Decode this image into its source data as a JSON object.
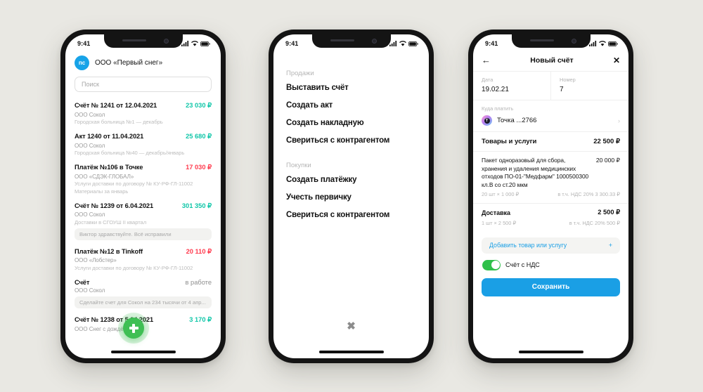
{
  "statusbar": {
    "time": "9:41",
    "signal_icon": "cellular-bars-icon",
    "wifi_icon": "wifi-icon",
    "battery_icon": "battery-icon"
  },
  "phone1": {
    "avatar_initials": "пс",
    "company": "ООО «Первый снег»",
    "search_placeholder": "Поиск",
    "fab_icon": "plus-icon",
    "items": [
      {
        "title": "Счёт № 1241 от 12.04.2021",
        "amount": "23 030 ₽",
        "amount_kind": "in",
        "sub": "ООО Сокол",
        "sub2": "Городская больница №1 — декабрь",
        "bubble": ""
      },
      {
        "title": "Акт 1240 от 11.04.2021",
        "amount": "25 680 ₽",
        "amount_kind": "in",
        "sub": "ООО Сокол",
        "sub2": "Городская больница №40 — декабрь/январь",
        "bubble": ""
      },
      {
        "title": "Платёж №106 в Точке",
        "amount": "17 030 ₽",
        "amount_kind": "out",
        "sub": "ООО «СДЭК-ГЛОБАЛ»",
        "sub2": "Услуги доставки по договору № КУ-РФ-ГЛ-11002",
        "sub3": "Материалы за январь",
        "bubble": ""
      },
      {
        "title": "Счёт № 1239 от 6.04.2021",
        "amount": "301 350 ₽",
        "amount_kind": "in",
        "sub": "ООО Сокол",
        "sub2": "Доставки в СГОУШ II квартал",
        "bubble": "Виктор здравствуйте. Всё исправили"
      },
      {
        "title": "Платёж №12 в Tinkoff",
        "amount": "20 110 ₽",
        "amount_kind": "out",
        "sub": "ООО «Лобстер»",
        "sub2": "Услуги доставки по договору № КУ-РФ-ГЛ-11002",
        "bubble": ""
      },
      {
        "title": "Счёт",
        "amount": "в работе",
        "amount_kind": "note",
        "sub": "ООО Сокол",
        "sub2": "",
        "bubble": "Сделайте счет для Сокол на 234 тысячи от 4 апр..."
      },
      {
        "title": "Счёт № 1238 от 5.04.2021",
        "amount": "3 170 ₽",
        "amount_kind": "in",
        "sub": "ООО Снег с дождём",
        "sub2": "",
        "bubble": ""
      }
    ]
  },
  "phone2": {
    "close_icon": "close-x-icon",
    "groups": [
      {
        "label": "Продажи",
        "items": [
          "Выставить счёт",
          "Создать акт",
          "Создать накладную",
          "Свериться с контрагентом"
        ]
      },
      {
        "label": "Покупки",
        "items": [
          "Создать платёжку",
          "Учесть первичку",
          "Свериться с контрагентом"
        ]
      }
    ]
  },
  "phone3": {
    "back_icon": "arrow-left-icon",
    "title": "Новый счёт",
    "close_icon": "close-x-icon",
    "date_label": "Дата",
    "date_value": "19.02.21",
    "number_label": "Номер",
    "number_value": "7",
    "pay_label": "Куда платить",
    "pay_account": "Точка ...2766",
    "pay_avatar_letter": "Т",
    "chevron_icon": "chevron-right-icon",
    "goods_label": "Товары и услуги",
    "goods_total": "22 500 ₽",
    "items": [
      {
        "name": "Пакет одноразовый для сбора, хранения и удаления медицинских отходов ПО-01-\"Медфарм\" 1000500300 кл.В со ст.20 мкм",
        "price": "20 000 ₽",
        "qty": "20 шт × 1 000 ₽",
        "vat": "в т.ч. НДС 20% 3 300.33 ₽",
        "bold": false
      },
      {
        "name": "Доставка",
        "price": "2 500 ₽",
        "qty": "1 шт × 2 500 ₽",
        "vat": "в т.ч. НДС 20% 500 ₽",
        "bold": true
      }
    ],
    "add_label": "Добавить товар или услугу",
    "add_icon": "plus-icon",
    "vat_toggle_label": "Счёт с  НДС",
    "vat_toggle_on": true,
    "save_label": "Сохранить"
  },
  "colors": {
    "page_bg": "#E9E8E3",
    "accent_blue": "#1A9FE5",
    "income_green": "#0FC6A8",
    "expense_red": "#FF3B4E",
    "fab_green": "#3FBF54",
    "toggle_green": "#2FC04A"
  }
}
